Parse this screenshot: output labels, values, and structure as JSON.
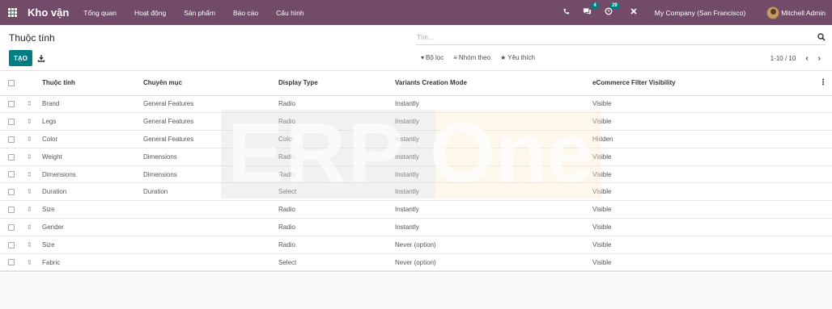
{
  "navbar": {
    "app_name": "Kho vận",
    "menu": [
      "Tổng quan",
      "Hoạt động",
      "Sản phẩm",
      "Báo cáo",
      "Cấu hình"
    ],
    "messages_count": "4",
    "activities_count": "29",
    "company": "My Company (San Francisco)",
    "user": "Mitchell Admin",
    "accent_color": "#714b67"
  },
  "control": {
    "title": "Thuộc tính",
    "search_placeholder": "Tìm...",
    "create_label": "TẠO",
    "filters_label": "Bộ lọc",
    "group_by_label": "Nhóm theo",
    "favorites_label": "Yêu thích",
    "pager": "1-10 / 10",
    "primary_color": "#017e84"
  },
  "table": {
    "headers": [
      "Thuộc tính",
      "Chuyên mục",
      "Display Type",
      "Variants Creation Mode",
      "eCommerce Filter Visibility"
    ],
    "rows": [
      [
        "Brand",
        "General Features",
        "Radio",
        "Instantly",
        "Visible"
      ],
      [
        "Legs",
        "General Features",
        "Radio",
        "Instantly",
        "Visible"
      ],
      [
        "Color",
        "General Features",
        "Color",
        "Instantly",
        "Hidden"
      ],
      [
        "Weight",
        "Dimensions",
        "Radio",
        "Instantly",
        "Visible"
      ],
      [
        "Dimensions",
        "Dimensions",
        "Radio",
        "Instantly",
        "Visible"
      ],
      [
        "Duration",
        "Duration",
        "Select",
        "Instantly",
        "Visible"
      ],
      [
        "Size",
        "",
        "Radio",
        "Instantly",
        "Visible"
      ],
      [
        "Gender",
        "",
        "Radio",
        "Instantly",
        "Visible"
      ],
      [
        "Size",
        "",
        "Radio",
        "Never (option)",
        "Visible"
      ],
      [
        "Fabric",
        "",
        "Select",
        "Never (option)",
        "Visible"
      ]
    ]
  },
  "watermark": {
    "left": "ERP",
    "right": "One"
  }
}
